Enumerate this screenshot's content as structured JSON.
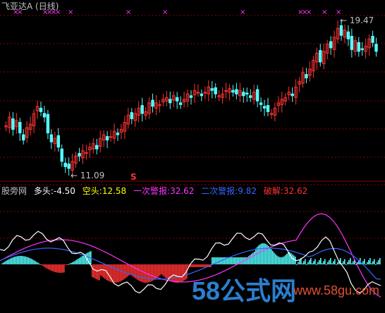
{
  "main_panel": {
    "title": "飞亚达A (日线)",
    "high_label": "19.47",
    "low_label": "11.09",
    "signal_mark": "S",
    "colors": {
      "up": "#ff3232",
      "down": "#54fcfc",
      "mark": "#ff33ff",
      "grid": "#8b0000",
      "text": "#c0c0c0"
    }
  },
  "indicator": {
    "name": "股旁网",
    "items": [
      {
        "label": "多头:",
        "value": "-4.50",
        "color": "#ffffff"
      },
      {
        "label": "空头:",
        "value": "12.58",
        "color": "#ffff00"
      },
      {
        "label": "一次警报:",
        "value": "32.62",
        "color": "#ff33ff"
      },
      {
        "label": "二次警报:",
        "value": "9.82",
        "color": "#3366ff"
      },
      {
        "label": "破解:",
        "value": "32.62",
        "color": "#ff3232"
      }
    ]
  },
  "watermark": {
    "main": "58公式网",
    "url": "www.58gu.com"
  },
  "chart_data": {
    "type": "candlestick",
    "title": "飞亚达A (日线)",
    "annotations": [
      "19.47",
      "11.09"
    ],
    "close_values": [
      13.6,
      14.1,
      13.4,
      13.9,
      13.2,
      12.8,
      13.5,
      13.7,
      14.3,
      14.7,
      14.4,
      14.1,
      13.2,
      12.7,
      12.9,
      12.4,
      11.6,
      11.3,
      11.2,
      11.6,
      11.9,
      11.9,
      12.2,
      12.1,
      12.4,
      12.6,
      12.3,
      12.9,
      13.1,
      12.8,
      13.0,
      13.3,
      13.1,
      13.4,
      13.8,
      14.2,
      14.0,
      14.3,
      14.6,
      14.3,
      14.4,
      14.9,
      14.7,
      14.9,
      14.8,
      15.1,
      15.2,
      14.9,
      15.3,
      15.0,
      14.8,
      15.1,
      15.4,
      15.2,
      15.6,
      15.5,
      15.3,
      15.5,
      15.8,
      15.6,
      15.4,
      15.3,
      15.4,
      15.6,
      15.7,
      15.5,
      15.4,
      15.6,
      15.3,
      15.4,
      15.2,
      15.5,
      15.0,
      14.8,
      14.6,
      14.4,
      14.3,
      14.6,
      14.9,
      15.1,
      15.2,
      15.5,
      15.3,
      15.8,
      16.1,
      16.6,
      16.3,
      16.8,
      17.3,
      17.7,
      17.2,
      17.8,
      18.2,
      18.0,
      18.6,
      19.1,
      18.7,
      19.0,
      18.5,
      17.9,
      18.4,
      17.8,
      17.9,
      18.1,
      18.5,
      18.3,
      17.8
    ],
    "indicator_series": [
      "多头",
      "空头",
      "一次警报",
      "二次警报",
      "破解"
    ]
  }
}
